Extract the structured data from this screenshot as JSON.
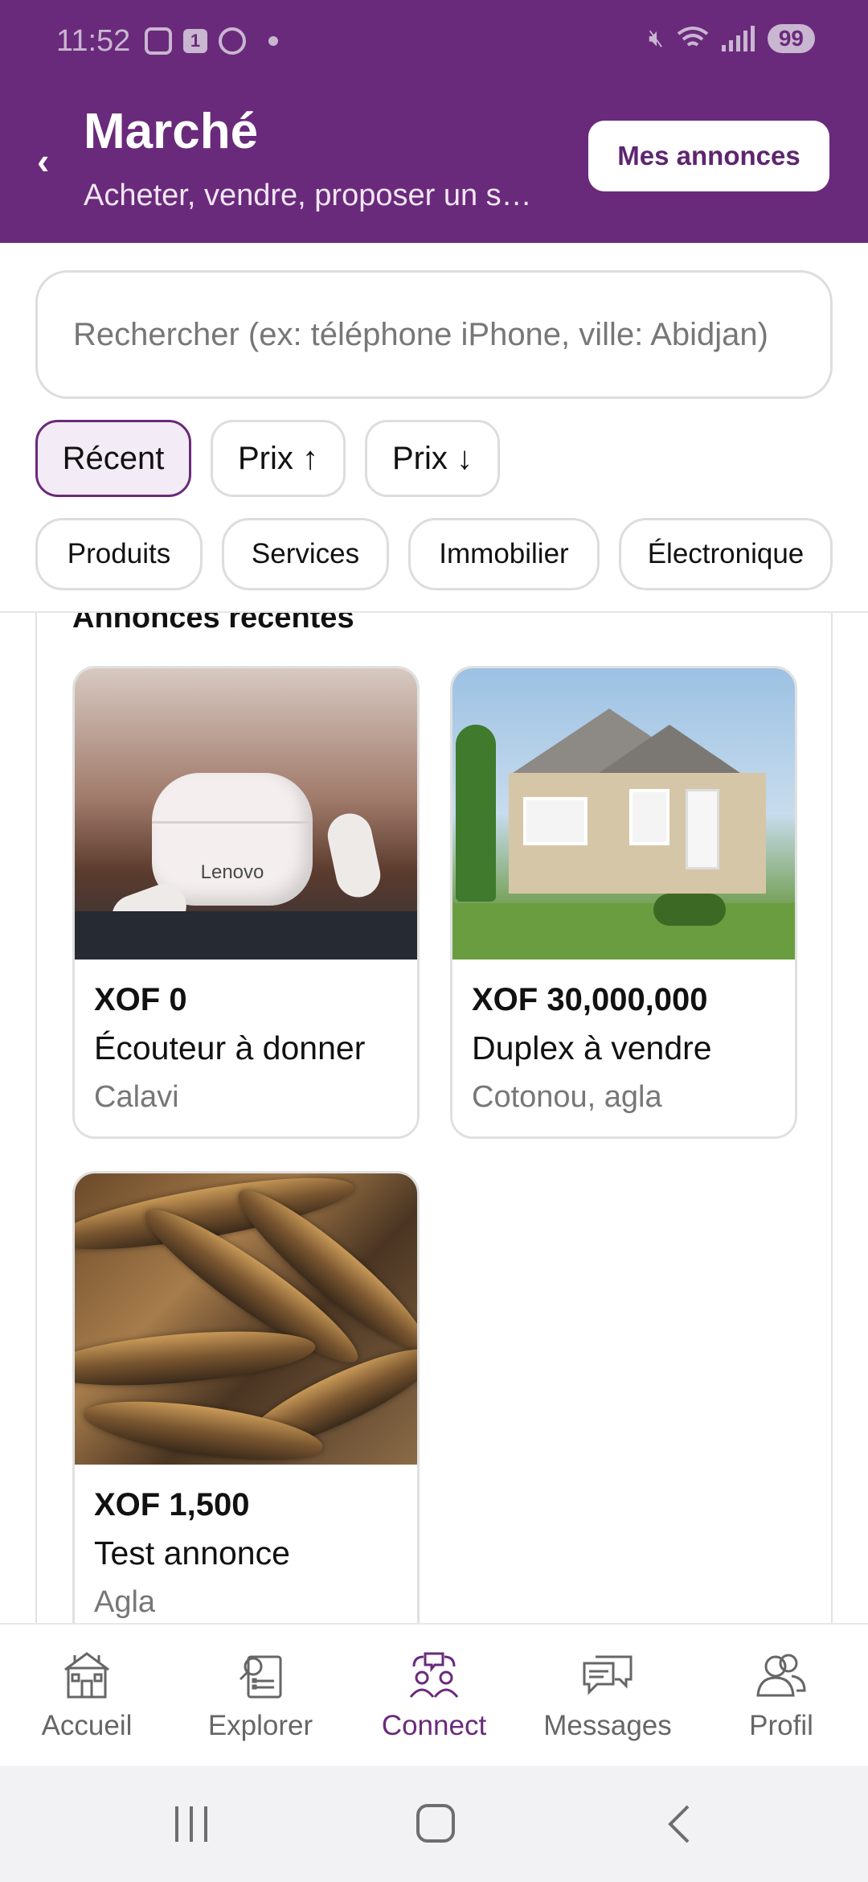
{
  "status_bar": {
    "time": "11:52",
    "notif_badge": "1",
    "battery": "99"
  },
  "header": {
    "title": "Marché",
    "subtitle": "Acheter, vendre, proposer un s…",
    "my_ads_button": "Mes annonces",
    "background": "#6a2a7b"
  },
  "search": {
    "placeholder": "Rechercher (ex: téléphone iPhone, ville: Abidjan)"
  },
  "sort_options": [
    {
      "label": "Récent",
      "active": true
    },
    {
      "label": "Prix ↑",
      "active": false
    },
    {
      "label": "Prix ↓",
      "active": false
    }
  ],
  "categories": [
    "Produits",
    "Services",
    "Immobilier",
    "Électronique"
  ],
  "section_title": "Annonces récentes",
  "listings": [
    {
      "price": "XOF 0",
      "title": "Écouteur à donner",
      "location": "Calavi",
      "image_logo_text": "Lenovo"
    },
    {
      "price": "XOF 30,000,000",
      "title": "Duplex à vendre",
      "location": "Cotonou, agla"
    },
    {
      "price": "XOF 1,500",
      "title": "Test annonce",
      "location": "Agla"
    }
  ],
  "bottom_nav": [
    {
      "label": "Accueil",
      "icon": "home-icon",
      "active": false
    },
    {
      "label": "Explorer",
      "icon": "explore-icon",
      "active": false
    },
    {
      "label": "Connect",
      "icon": "connect-icon",
      "active": true
    },
    {
      "label": "Messages",
      "icon": "messages-icon",
      "active": false
    },
    {
      "label": "Profil",
      "icon": "profile-icon",
      "active": false
    }
  ],
  "colors": {
    "accent": "#6a2a7b",
    "active_pill_bg": "#f3ecf6"
  }
}
